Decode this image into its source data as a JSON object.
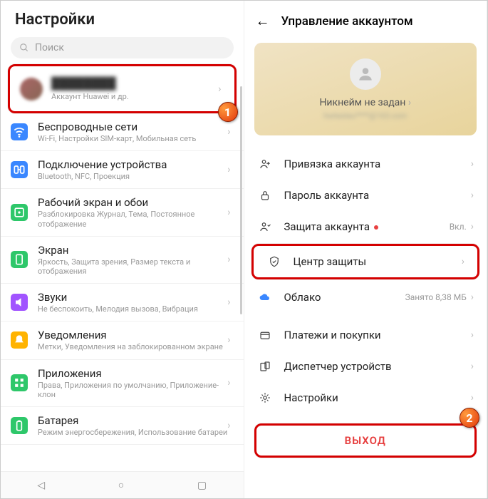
{
  "left": {
    "title": "Настройки",
    "searchPlaceholder": "Поиск",
    "account": {
      "name": "████████",
      "sub": "Аккаунт Huawei и др."
    },
    "items": [
      {
        "title": "Беспроводные сети",
        "sub": "Wi-Fi, Настройки SIM-карт, Мобильная сеть",
        "color": "#3a87ff"
      },
      {
        "title": "Подключение устройства",
        "sub": "Bluetooth, NFC, Проекция",
        "color": "#3a87ff"
      },
      {
        "title": "Рабочий экран и обои",
        "sub": "Разблокировка Журнал, Тема, Постоянное отображение",
        "color": "#2ec76a"
      },
      {
        "title": "Экран",
        "sub": "Яркость, Защита зрения, Размер текста и отображения",
        "color": "#2ec76a"
      },
      {
        "title": "Звуки",
        "sub": "Не беспокоить, Мелодия вызова, Вибрация",
        "color": "#a154ff"
      },
      {
        "title": "Уведомления",
        "sub": "Метки, Уведомления на заблокированном экране",
        "color": "#ffb300"
      },
      {
        "title": "Приложения",
        "sub": "Права, Приложения по умолчанию, Приложение-клон",
        "color": "#2ec76a"
      },
      {
        "title": "Батарея",
        "sub": "Режим энергосбережения, Использование батареи",
        "color": "#2ec76a"
      }
    ],
    "badge1": "1"
  },
  "right": {
    "title": "Управление аккаунтом",
    "nickname": "Никнейм не задан",
    "email": "hwtesteu****@163.com",
    "rowsA": [
      {
        "label": "Привязка аккаунта"
      },
      {
        "label": "Пароль аккаунта"
      },
      {
        "label": "Защита аккаунта",
        "right": "Вкл.",
        "dot": true
      }
    ],
    "security": {
      "label": "Центр защиты"
    },
    "cloud": {
      "label": "Облако",
      "right": "Занято 8,38 МБ"
    },
    "rowsB": [
      {
        "label": "Платежи и покупки"
      },
      {
        "label": "Диспетчер устройств"
      },
      {
        "label": "Настройки"
      }
    ],
    "logout": "ВЫХОД",
    "badge2": "2"
  }
}
